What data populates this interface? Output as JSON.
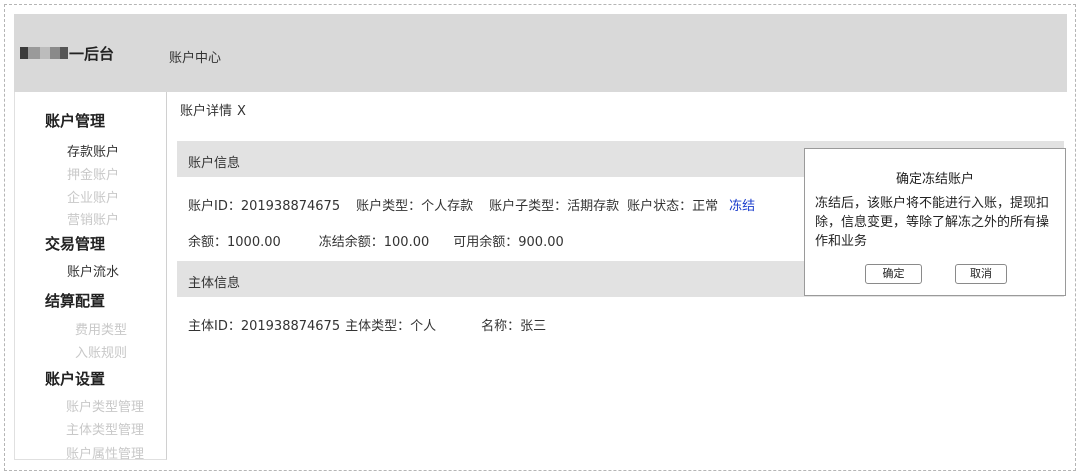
{
  "header": {
    "logo_suffix": "一后台",
    "nav_item": "账户中心"
  },
  "sidebar": {
    "groups": [
      {
        "title": "账户管理",
        "items": [
          {
            "label": "存款账户",
            "enabled": true
          },
          {
            "label": "押金账户",
            "enabled": false
          },
          {
            "label": "企业账户",
            "enabled": false
          },
          {
            "label": "营销账户",
            "enabled": false
          }
        ]
      },
      {
        "title": "交易管理",
        "items": [
          {
            "label": "账户流水",
            "enabled": true
          }
        ]
      },
      {
        "title": "结算配置",
        "items": [
          {
            "label": "费用类型",
            "enabled": false
          },
          {
            "label": "入账规则",
            "enabled": false
          }
        ]
      },
      {
        "title": "账户设置",
        "items": [
          {
            "label": "账户类型管理",
            "enabled": false
          },
          {
            "label": "主体类型管理",
            "enabled": false
          },
          {
            "label": "账户属性管理",
            "enabled": false
          }
        ]
      }
    ]
  },
  "breadcrumb": {
    "label": "账户详情",
    "close": "X"
  },
  "account_info": {
    "title": "账户信息",
    "account_id": "账户ID：201938874675",
    "account_type": "账户类型：个人存款",
    "sub_type": "账户子类型：活期存款",
    "status": "账户状态：正常",
    "freeze_link": "冻结",
    "balance": "余额：1000.00",
    "frozen_balance": "冻结余额：100.00",
    "available_balance": "可用余额：900.00"
  },
  "subject_info": {
    "title": "主体信息",
    "subject_id": "主体ID：201938874675",
    "subject_type": "主体类型：个人",
    "name": "名称：张三"
  },
  "modal": {
    "title": "确定冻结账户",
    "body": "冻结后，该账户将不能进行入账，提现扣除，信息变更，等除了解冻之外的所有操作和业务",
    "confirm": "确定",
    "cancel": "取消"
  },
  "colors": {
    "link": "#1a3ccc",
    "header_bg": "#d9d9d9",
    "section_bg": "#e2e2e2",
    "disabled_text": "#c8c8c8"
  }
}
